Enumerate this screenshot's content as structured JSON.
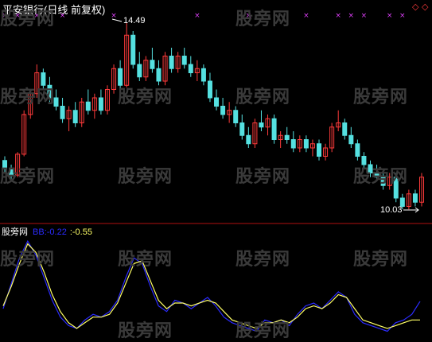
{
  "header": {
    "title": "平安银行(日线 前复权)",
    "nav_left_icon": "diamond-left-icon",
    "nav_right_icon": "diamond-right-icon",
    "nav_left_glyph": "◇",
    "nav_right_glyph": "◇"
  },
  "watermark": {
    "text": "股旁网"
  },
  "annotations": {
    "high_label": "14.49",
    "low_label": "10.03"
  },
  "indicator": {
    "title": "股旁网",
    "bb_label": "BB",
    "value1": ":-0.22",
    "value2": ":-0.55"
  },
  "colors": {
    "background": "#000000",
    "up_candle": "#ff3b3b",
    "down_candle": "#55e0e0",
    "divider": "#b01010",
    "marker": "#e040fb",
    "line_blue": "#2b2bff",
    "line_yellow": "#ffff66",
    "watermark": "#3a3a3a"
  },
  "chart_data": [
    {
      "type": "candlestick",
      "title": "平安银行(日线 前复权)",
      "annotations": [
        {
          "label": "14.49",
          "kind": "high"
        },
        {
          "label": "10.03",
          "kind": "low"
        }
      ],
      "ohlc": [
        [
          11.2,
          11.3,
          10.9,
          11.0
        ],
        [
          11.0,
          11.1,
          10.75,
          10.85
        ],
        [
          10.85,
          11.4,
          10.8,
          11.35
        ],
        [
          11.35,
          12.4,
          11.3,
          12.3
        ],
        [
          12.3,
          12.9,
          12.2,
          12.8
        ],
        [
          12.8,
          13.5,
          12.7,
          13.3
        ],
        [
          13.3,
          13.4,
          12.9,
          13.0
        ],
        [
          13.0,
          13.2,
          12.6,
          12.7
        ],
        [
          12.7,
          12.9,
          12.4,
          12.5
        ],
        [
          12.5,
          12.7,
          12.1,
          12.2
        ],
        [
          12.2,
          12.5,
          11.9,
          12.4
        ],
        [
          12.4,
          12.6,
          12.0,
          12.1
        ],
        [
          12.1,
          12.7,
          12.0,
          12.6
        ],
        [
          12.6,
          12.9,
          12.3,
          12.4
        ],
        [
          12.4,
          12.8,
          12.2,
          12.7
        ],
        [
          12.7,
          12.9,
          12.3,
          12.4
        ],
        [
          12.4,
          13.0,
          12.3,
          12.9
        ],
        [
          12.9,
          13.5,
          12.8,
          13.4
        ],
        [
          13.4,
          13.6,
          12.9,
          13.0
        ],
        [
          13.0,
          14.49,
          12.95,
          14.2
        ],
        [
          14.2,
          14.3,
          13.4,
          13.5
        ],
        [
          13.5,
          13.8,
          13.1,
          13.2
        ],
        [
          13.2,
          13.7,
          13.1,
          13.6
        ],
        [
          13.6,
          13.9,
          13.3,
          13.4
        ],
        [
          13.4,
          13.6,
          13.0,
          13.1
        ],
        [
          13.1,
          13.8,
          13.0,
          13.7
        ],
        [
          13.7,
          13.9,
          13.3,
          13.4
        ],
        [
          13.4,
          13.8,
          13.3,
          13.7
        ],
        [
          13.7,
          13.9,
          13.4,
          13.5
        ],
        [
          13.5,
          13.7,
          13.2,
          13.3
        ],
        [
          13.3,
          13.6,
          13.1,
          13.4
        ],
        [
          13.4,
          13.5,
          13.0,
          13.1
        ],
        [
          13.1,
          13.3,
          12.6,
          12.7
        ],
        [
          12.7,
          12.9,
          12.4,
          12.5
        ],
        [
          12.5,
          12.7,
          12.2,
          12.3
        ],
        [
          12.3,
          12.6,
          12.1,
          12.4
        ],
        [
          12.4,
          12.5,
          12.0,
          12.1
        ],
        [
          12.1,
          12.3,
          11.7,
          11.8
        ],
        [
          11.8,
          12.0,
          11.5,
          11.6
        ],
        [
          11.6,
          12.2,
          11.5,
          12.1
        ],
        [
          12.1,
          12.4,
          11.9,
          12.0
        ],
        [
          12.0,
          12.3,
          11.8,
          12.2
        ],
        [
          12.2,
          12.3,
          11.6,
          11.7
        ],
        [
          11.7,
          11.9,
          11.5,
          11.8
        ],
        [
          11.8,
          12.0,
          11.6,
          11.7
        ],
        [
          11.7,
          11.9,
          11.4,
          11.5
        ],
        [
          11.5,
          11.8,
          11.4,
          11.7
        ],
        [
          11.7,
          11.8,
          11.4,
          11.5
        ],
        [
          11.5,
          11.7,
          11.3,
          11.6
        ],
        [
          11.6,
          11.7,
          11.2,
          11.3
        ],
        [
          11.3,
          11.6,
          11.2,
          11.5
        ],
        [
          11.5,
          12.1,
          11.4,
          12.0
        ],
        [
          12.0,
          12.4,
          11.9,
          12.1
        ],
        [
          12.1,
          12.2,
          11.7,
          11.8
        ],
        [
          11.8,
          12.0,
          11.5,
          11.6
        ],
        [
          11.6,
          11.7,
          11.2,
          11.3
        ],
        [
          11.3,
          11.4,
          11.0,
          11.1
        ],
        [
          11.1,
          11.2,
          10.8,
          10.9
        ],
        [
          10.9,
          11.1,
          10.7,
          10.8
        ],
        [
          10.8,
          10.9,
          10.5,
          10.6
        ],
        [
          10.6,
          10.9,
          10.5,
          10.8
        ],
        [
          10.8,
          10.9,
          10.2,
          10.3
        ],
        [
          10.3,
          10.4,
          10.03,
          10.1
        ],
        [
          10.1,
          10.5,
          10.03,
          10.4
        ],
        [
          10.4,
          10.5,
          10.1,
          10.2
        ],
        [
          10.2,
          10.9,
          10.1,
          10.8
        ]
      ]
    },
    {
      "type": "line",
      "title": "股旁网",
      "series": [
        {
          "name": "BB",
          "color": "#2b2bff",
          "values": [
            -0.35,
            0.1,
            0.55,
            0.85,
            0.6,
            0.2,
            -0.2,
            -0.5,
            -0.65,
            -0.7,
            -0.55,
            -0.45,
            -0.5,
            -0.4,
            -0.2,
            0.2,
            0.55,
            0.45,
            0.05,
            -0.3,
            -0.4,
            -0.2,
            -0.25,
            -0.35,
            -0.25,
            -0.15,
            -0.3,
            -0.5,
            -0.6,
            -0.65,
            -0.7,
            -0.75,
            -0.55,
            -0.6,
            -0.55,
            -0.65,
            -0.45,
            -0.3,
            -0.25,
            -0.35,
            -0.2,
            -0.05,
            -0.15,
            -0.45,
            -0.6,
            -0.65,
            -0.7,
            -0.75,
            -0.6,
            -0.55,
            -0.45,
            -0.22
          ]
        },
        {
          "name": "",
          "color": "#ffff66",
          "values": [
            -0.3,
            0.05,
            0.45,
            0.8,
            0.65,
            0.3,
            -0.1,
            -0.4,
            -0.6,
            -0.7,
            -0.6,
            -0.5,
            -0.5,
            -0.45,
            -0.25,
            0.1,
            0.45,
            0.5,
            0.15,
            -0.2,
            -0.35,
            -0.25,
            -0.25,
            -0.3,
            -0.25,
            -0.2,
            -0.25,
            -0.4,
            -0.55,
            -0.6,
            -0.65,
            -0.7,
            -0.6,
            -0.6,
            -0.55,
            -0.6,
            -0.5,
            -0.35,
            -0.3,
            -0.35,
            -0.25,
            -0.1,
            -0.15,
            -0.35,
            -0.55,
            -0.6,
            -0.65,
            -0.7,
            -0.65,
            -0.6,
            -0.55,
            -0.55
          ]
        }
      ]
    }
  ]
}
